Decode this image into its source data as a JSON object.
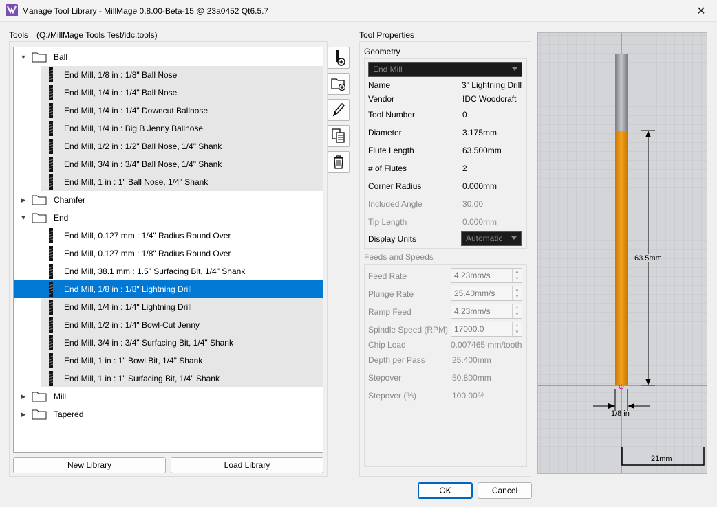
{
  "window": {
    "title": "Manage Tool Library - MillMage 0.8.00-Beta-15 @ 23a0452 Qt6.5.7"
  },
  "tools": {
    "label": "Tools",
    "path": "(Q:/MillMage Tools Test/idc.tools)",
    "groups": [
      {
        "label": "Ball",
        "expanded": true
      },
      {
        "label": "Chamfer",
        "expanded": false
      },
      {
        "label": "End",
        "expanded": true
      },
      {
        "label": "Mill",
        "expanded": false
      },
      {
        "label": "Tapered",
        "expanded": false
      }
    ],
    "ball_items": [
      "End Mill, 1/8 in : 1/8\" Ball Nose",
      "End Mill, 1/4 in : 1/4\" Ball Nose",
      "End Mill, 1/4 in : 1/4\" Downcut Ballnose",
      "End Mill, 1/4 in : Big B Jenny Ballnose",
      "End Mill, 1/2 in : 1/2\" Ball Nose, 1/4\" Shank",
      "End Mill, 3/4 in : 3/4\" Ball Nose, 1/4\" Shank",
      "End Mill, 1 in : 1\" Ball Nose, 1/4\" Shank"
    ],
    "end_items": [
      "End Mill, 0.127 mm : 1/4\" Radius Round Over",
      "End Mill, 0.127 mm : 1/8\" Radius Round Over",
      "End Mill, 38.1 mm : 1.5\" Surfacing Bit, 1/4\" Shank",
      "End Mill, 1/8 in : 1/8\" Lightning Drill",
      "End Mill, 1/4 in : 1/4\" Lightning Drill",
      "End Mill, 1/2 in : 1/4\" Bowl-Cut Jenny",
      "End Mill, 3/4 in : 3/4\" Surfacing Bit, 1/4\" Shank",
      "End Mill, 1 in : 1\" Bowl Bit, 1/4\" Shank",
      "End Mill, 1 in : 1\" Surfacing Bit, 1/4\" Shank"
    ],
    "new_library": "New Library",
    "load_library": "Load Library"
  },
  "properties": {
    "title": "Tool Properties",
    "geometry": {
      "label": "Geometry",
      "tool_type": "End Mill",
      "name_label": "Name",
      "name_value": "3\" Lightning Drill",
      "vendor_label": "Vendor",
      "vendor_value": "IDC Woodcraft",
      "tool_number_label": "Tool Number",
      "tool_number_value": "0",
      "diameter_label": "Diameter",
      "diameter_value": "3.175mm",
      "flute_length_label": "Flute Length",
      "flute_length_value": "63.500mm",
      "flutes_label": "# of Flutes",
      "flutes_value": "2",
      "corner_radius_label": "Corner Radius",
      "corner_radius_value": "0.000mm",
      "included_angle_label": "Included Angle",
      "included_angle_value": "30.00",
      "tip_length_label": "Tip Length",
      "tip_length_value": "0.000mm",
      "display_units_label": "Display Units",
      "display_units_value": "Automatic"
    },
    "feeds": {
      "label": "Feeds and Speeds",
      "feed_rate_label": "Feed Rate",
      "feed_rate_value": "4.23mm/s",
      "plunge_rate_label": "Plunge Rate",
      "plunge_rate_value": "25.40mm/s",
      "ramp_feed_label": "Ramp Feed",
      "ramp_feed_value": "4.23mm/s",
      "spindle_label": "Spindle Speed (RPM)",
      "spindle_value": "17000.0",
      "chip_load_label": "Chip Load",
      "chip_load_value": "0.007465 mm/tooth",
      "depth_label": "Depth per Pass",
      "depth_value": "25.400mm",
      "stepover_label": "Stepover",
      "stepover_value": "50.800mm",
      "stepover_pct_label": "Stepover (%)",
      "stepover_pct_value": "100.00%"
    }
  },
  "preview": {
    "flute_dim": "63.5mm",
    "diameter_dim": "1/8 in",
    "scale_dim": "21mm",
    "colors": {
      "shank": "#9a9aa2",
      "flute": "#e8950f",
      "axis": "#3b7fd0",
      "baseline": "#d23b3b"
    }
  },
  "buttons": {
    "ok": "OK",
    "cancel": "Cancel"
  }
}
